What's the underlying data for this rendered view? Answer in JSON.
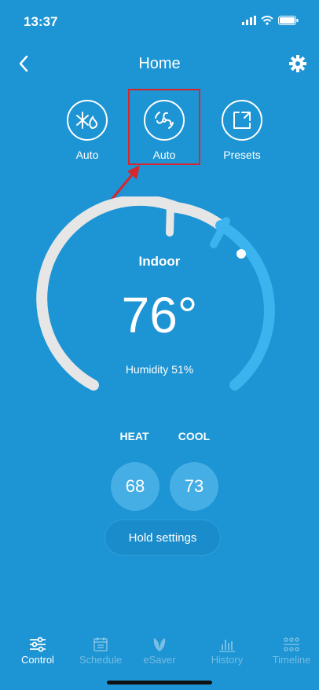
{
  "status_bar": {
    "time": "13:37"
  },
  "header": {
    "title": "Home"
  },
  "modes": [
    {
      "label": "Auto"
    },
    {
      "label": "Auto"
    },
    {
      "label": "Presets"
    }
  ],
  "thermostat": {
    "indoor_label": "Indoor",
    "temperature": "76°",
    "humidity": "Humidity 51%"
  },
  "setpoints": {
    "heat_label": "HEAT",
    "cool_label": "COOL",
    "heat_value": "68",
    "cool_value": "73"
  },
  "hold": {
    "label": "Hold settings"
  },
  "tabs": [
    {
      "label": "Control",
      "icon": "sliders-icon",
      "active": true
    },
    {
      "label": "Schedule",
      "icon": "calendar-icon",
      "active": false
    },
    {
      "label": "eSaver",
      "icon": "leaf-icon",
      "active": false
    },
    {
      "label": "History",
      "icon": "bar-chart-icon",
      "active": false
    },
    {
      "label": "Timeline",
      "icon": "timeline-icon",
      "active": false
    }
  ],
  "colors": {
    "background": "#1d94d3",
    "highlight": "#d7262c",
    "cool_arc": "#3ab3ee"
  }
}
